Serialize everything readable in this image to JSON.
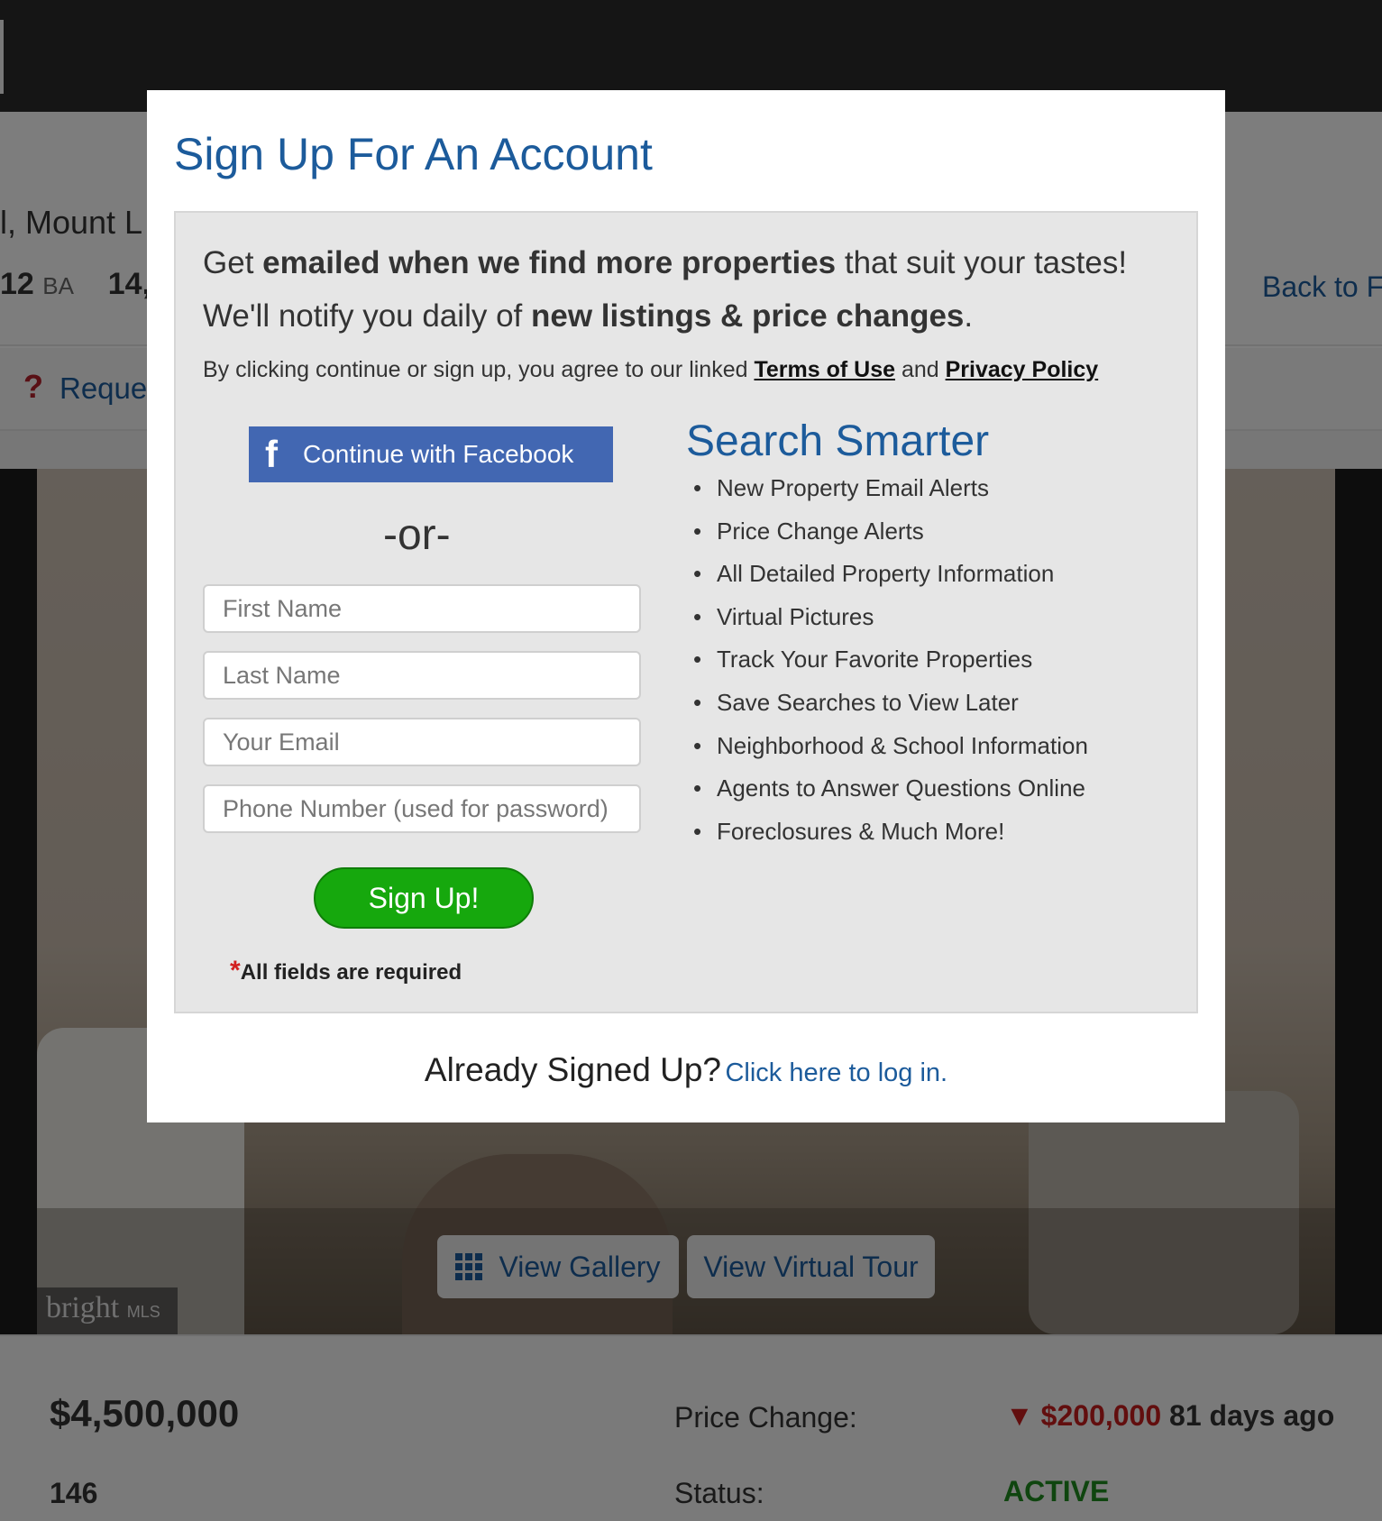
{
  "background": {
    "address_fragment": "l, Mount L",
    "stats": {
      "baths": "12",
      "baths_unit": "BA",
      "sqft_fragment": "14,"
    },
    "back_link": "Back to F",
    "request_link": "Reque",
    "photo": {
      "watermark_brand": "bright",
      "watermark_mls": "MLS",
      "view_gallery_label": "View Gallery",
      "view_virtual_tour_label": "View Virtual Tour"
    },
    "details": {
      "price": "$4,500,000",
      "secondary_value": "146",
      "price_change_label": "Price Change:",
      "price_change_amount": "$200,000",
      "price_change_ago": "81 days ago",
      "status_label": "Status:",
      "status_value": "ACTIVE"
    }
  },
  "modal": {
    "title": "Sign Up For An Account",
    "intro": {
      "line1_pre": "Get ",
      "line1_bold": "emailed when we find more properties",
      "line1_post": " that suit your tastes!",
      "line2_pre": "We'll notify you daily of ",
      "line2_bold": "new listings & price changes",
      "line2_post": "."
    },
    "terms": {
      "pre": "By clicking continue or sign up, you agree to our linked ",
      "terms_link": "Terms of Use",
      "mid": " and ",
      "privacy_link": "Privacy Policy"
    },
    "facebook_button": "Continue with Facebook",
    "or_text": "-or-",
    "fields": {
      "first_name_placeholder": "First Name",
      "last_name_placeholder": "Last Name",
      "email_placeholder": "Your Email",
      "phone_placeholder": "Phone Number (used for password)"
    },
    "signup_button": "Sign Up!",
    "required_note": "All fields are required",
    "search_smarter_title": "Search Smarter",
    "features": [
      "New Property Email Alerts",
      "Price Change Alerts",
      "All Detailed Property Information",
      "Virtual Pictures",
      "Track Your Favorite Properties",
      "Save Searches to View Later",
      "Neighborhood & School Information",
      "Agents to Answer Questions Online",
      "Foreclosures & Much More!"
    ],
    "already_signed_up": "Already Signed Up?",
    "login_link": "Click here to log in."
  },
  "colors": {
    "brand_blue": "#1c5b9b",
    "facebook_blue": "#4267b2",
    "signup_green": "#16a80d",
    "price_drop_red": "#c41d1d",
    "active_green": "#1f8a1f"
  }
}
